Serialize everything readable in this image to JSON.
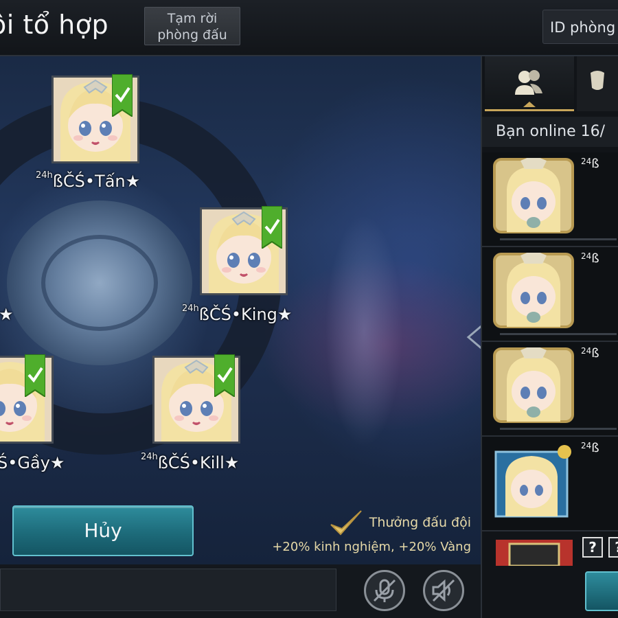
{
  "header": {
    "title": "ội tổ hợp",
    "leave_line1": "Tạm rời",
    "leave_line2": "phòng đấu",
    "room_id_label": "ID phòng"
  },
  "players": [
    {
      "prefix": "24h",
      "name": "ßČŚ•Tấn★"
    },
    {
      "prefix": "24h",
      "name": "ßČŚ•King★"
    },
    {
      "prefix": "",
      "name": "★"
    },
    {
      "prefix": "",
      "name": "Ś•Gầy★"
    },
    {
      "prefix": "24h",
      "name": "ßČŚ•Kill★"
    }
  ],
  "controls": {
    "cancel_label": "Hủy",
    "reward_title": "Thưởng đấu đội",
    "reward_desc": "+20% kinh nghiệm, +20% Vàng"
  },
  "friends_panel": {
    "online_label": "Bạn online 16/",
    "rows": [
      {
        "tag_prefix": "24",
        "tag_letter": "ß"
      },
      {
        "tag_prefix": "24",
        "tag_letter": "ß"
      },
      {
        "tag_prefix": "24",
        "tag_letter": "ß"
      },
      {
        "tag_prefix": "24",
        "tag_letter": "ß"
      }
    ],
    "unknown_box": "?"
  },
  "colors": {
    "accent_teal": "#1d6b7a",
    "ready_green": "#4fae2c",
    "gold": "#c8a65a"
  }
}
